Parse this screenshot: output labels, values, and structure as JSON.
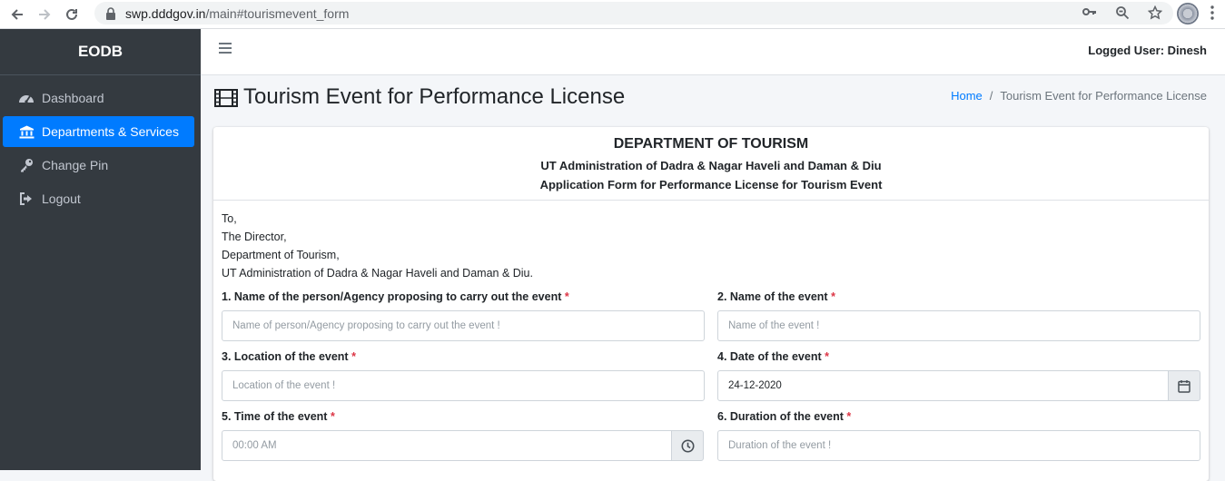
{
  "browser": {
    "url_host": "swp.dddgov.in",
    "url_path": "/main#tourismevent_form"
  },
  "sidebar": {
    "brand": "EODB",
    "items": [
      {
        "label": "Dashboard",
        "icon": "tachometer-icon",
        "active": false
      },
      {
        "label": "Departments & Services",
        "icon": "bank-icon",
        "active": true
      },
      {
        "label": "Change Pin",
        "icon": "key-icon",
        "active": false
      },
      {
        "label": "Logout",
        "icon": "sign-out-icon",
        "active": false
      }
    ]
  },
  "topbar": {
    "logged_user": "Logged User: Dinesh"
  },
  "header": {
    "title": "Tourism Event for Performance License",
    "breadcrumb": {
      "home": "Home",
      "current": "Tourism Event for Performance License"
    }
  },
  "form": {
    "department": "DEPARTMENT OF TOURISM",
    "administration": "UT Administration of Dadra & Nagar Haveli and Daman & Diu",
    "form_title": "Application Form for Performance License for Tourism Event",
    "address": [
      "To,",
      "The Director,",
      "Department of Tourism,",
      "UT Administration of Dadra & Nagar Haveli and Daman & Diu."
    ],
    "fields": {
      "f1": {
        "label": "1. Name of the person/Agency proposing to carry out the event",
        "placeholder": "Name of person/Agency proposing to carry out the event !",
        "value": ""
      },
      "f2": {
        "label": "2. Name of the event",
        "placeholder": "Name of the event !",
        "value": ""
      },
      "f3": {
        "label": "3. Location of the event",
        "placeholder": "Location of the event !",
        "value": ""
      },
      "f4": {
        "label": "4. Date of the event",
        "placeholder": "",
        "value": "24-12-2020"
      },
      "f5": {
        "label": "5. Time of the event",
        "placeholder": "00:00 AM",
        "value": ""
      },
      "f6": {
        "label": "6. Duration of the event",
        "placeholder": "Duration of the event !",
        "value": ""
      }
    },
    "required_mark": "*"
  },
  "colors": {
    "sidebar_bg": "#343a40",
    "active_item": "#007bff",
    "required": "#dc3545",
    "link": "#007bff"
  }
}
